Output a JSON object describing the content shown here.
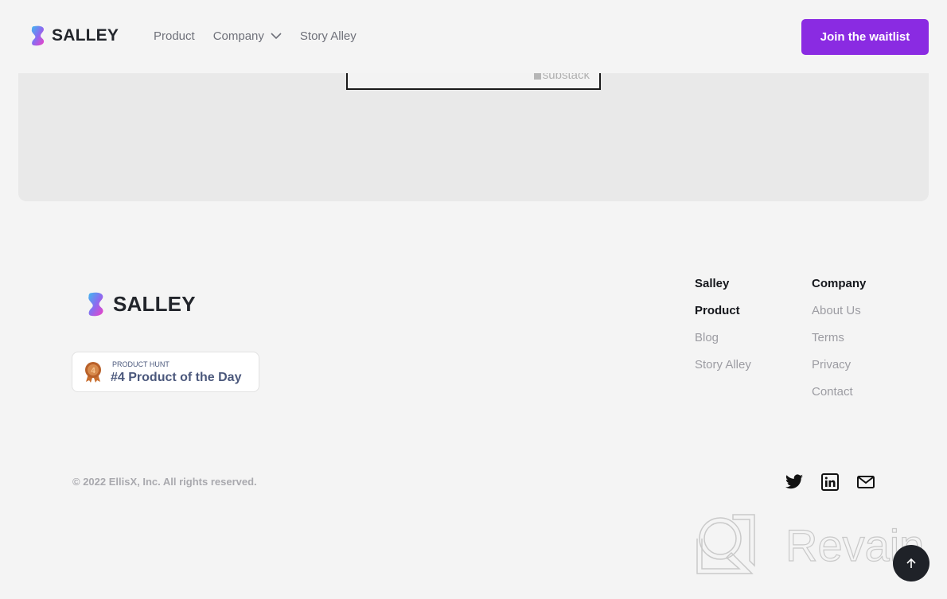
{
  "header": {
    "brand": "SALLEY",
    "nav": [
      {
        "label": "Product",
        "has_dropdown": false
      },
      {
        "label": "Company",
        "has_dropdown": true
      },
      {
        "label": "Story Alley",
        "has_dropdown": false
      }
    ],
    "cta_label": "Join the waitlist"
  },
  "colors": {
    "accent": "#8a2be2",
    "background": "#f4f4f4",
    "panel": "#e9e9e9",
    "dark": "#1f2228",
    "muted_link": "#9c9ca2"
  },
  "embed": {
    "provider_label": "substack"
  },
  "footer": {
    "brand": "SALLEY",
    "badge": {
      "kicker": "PRODUCT HUNT",
      "title": "#4 Product of the Day",
      "rank": "4",
      "icon": "medal-icon"
    },
    "columns": [
      {
        "heading": "Salley",
        "links": [
          {
            "label": "Product",
            "active": true
          },
          {
            "label": "Blog",
            "active": false
          },
          {
            "label": "Story Alley",
            "active": false
          }
        ]
      },
      {
        "heading": "Company",
        "links": [
          {
            "label": "About Us",
            "active": false
          },
          {
            "label": "Terms",
            "active": false
          },
          {
            "label": "Privacy",
            "active": false
          },
          {
            "label": "Contact",
            "active": false
          }
        ]
      }
    ],
    "copyright": "© 2022 EllisX, Inc. All rights reserved.",
    "social": [
      "twitter-icon",
      "linkedin-icon",
      "mail-icon"
    ]
  },
  "watermark": {
    "text": "Revain"
  },
  "scroll_top": {
    "icon": "arrow-up-icon"
  }
}
